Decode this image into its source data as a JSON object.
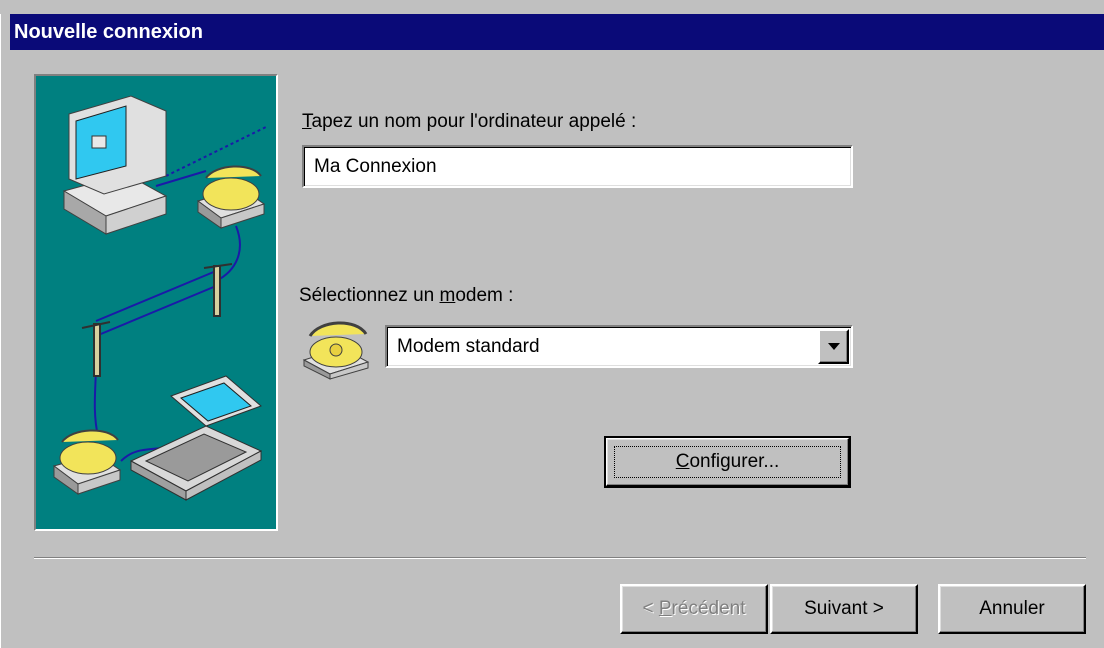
{
  "window": {
    "title": "Nouvelle connexion"
  },
  "name_field": {
    "label_accel": "T",
    "label_rest": "apez un nom pour l'ordinateur appelé :",
    "value": "Ma Connexion"
  },
  "modem": {
    "label_before": "Sélectionnez un ",
    "label_accel": "m",
    "label_after": "odem :",
    "selected": "Modem standard",
    "icon": "telephone-modem-icon"
  },
  "configure_button": {
    "accel": "C",
    "rest": "onfigurer..."
  },
  "footer": {
    "back_prefix": "< ",
    "back_accel": "P",
    "back_rest": "récédent",
    "next_label": "Suivant >",
    "cancel_label": "Annuler"
  },
  "colors": {
    "title_bar": "#0a0a78",
    "face": "#c0c0c0",
    "illustration_bg": "#008080"
  }
}
